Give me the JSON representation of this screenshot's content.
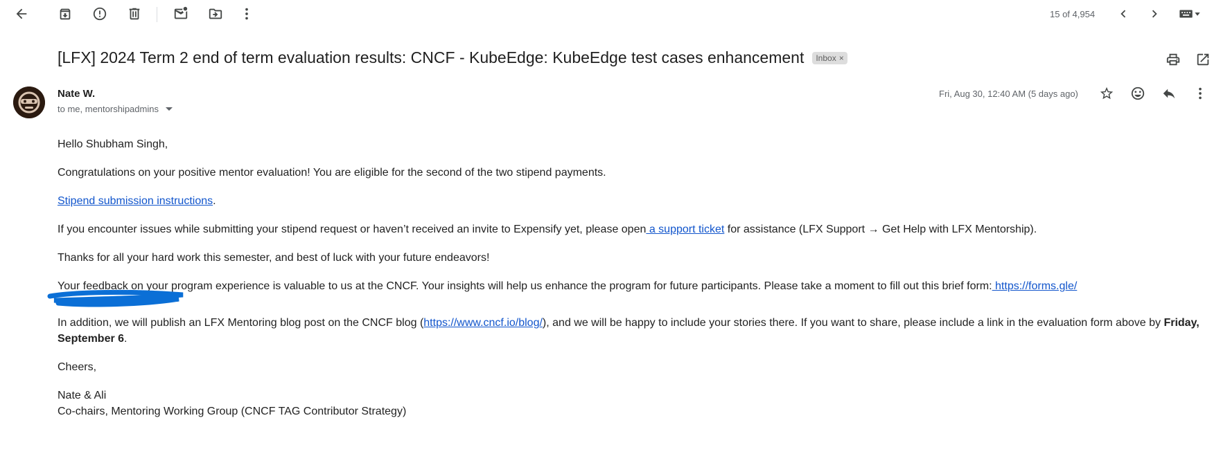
{
  "toolbar": {
    "icons": [
      "back-arrow-icon",
      "archive-icon",
      "report-spam-icon",
      "delete-icon",
      "mark-unread-icon",
      "move-to-icon",
      "more-vert-icon"
    ],
    "counter": "15 of 4,954",
    "nav_icons": [
      "chevron-left-icon",
      "chevron-right-icon",
      "keyboard-icon"
    ]
  },
  "email": {
    "subject": "[LFX] 2024 Term 2 end of term evaluation results: CNCF - KubeEdge: KubeEdge test cases enhancement",
    "label": "Inbox",
    "label_close": "×",
    "sender": "Nate W.",
    "recipients": "to me, mentorshipadmins",
    "date": "Fri, Aug 30, 12:40 AM (5 days ago)",
    "header_icons": [
      "print-icon",
      "open-new-window-icon"
    ],
    "action_icons": [
      "star-icon",
      "emoji-icon",
      "reply-icon",
      "more-vert-icon"
    ]
  },
  "body": {
    "greeting": "Hello Shubham Singh,",
    "congrats": "Congratulations on your positive mentor evaluation! You are eligible for the second of the two stipend payments.",
    "stipend_link": "Stipend submission instructions",
    "stipend_after": ".",
    "issues_before": "If you encounter issues while submitting your stipend request or haven’t received an invite to Expensify yet, please open",
    "issues_link": " a support ticket",
    "issues_after": " for assistance (LFX Support → Get Help with LFX Mentorship).",
    "thanks": "Thanks for all your hard work this semester, and best of luck with your future endeavors!",
    "feedback_before": "Your feedback on your program experience is valuable to us at the CNCF. Your insights will help us enhance the program for future participants. Please take a moment to fill out this brief form:",
    "feedback_link": " https://forms.gle/",
    "blog_before": "In addition, we will publish an LFX Mentoring blog post on the CNCF blog (",
    "blog_link": "https://www.cncf.io/blog/",
    "blog_after": "), and we will be happy to include your stories there. If you want to share, please include a link in the evaluation form above by ",
    "deadline": "Friday, September 6",
    "deadline_after": ".",
    "cheers": "Cheers,",
    "sign_names": "Nate & Ali",
    "sign_title": "Co-chairs, Mentoring Working Group (CNCF TAG Contributor Strategy)"
  },
  "colors": {
    "link": "#1155cc",
    "chip_bg": "#dddddd",
    "redaction": "#0b6fd6"
  }
}
